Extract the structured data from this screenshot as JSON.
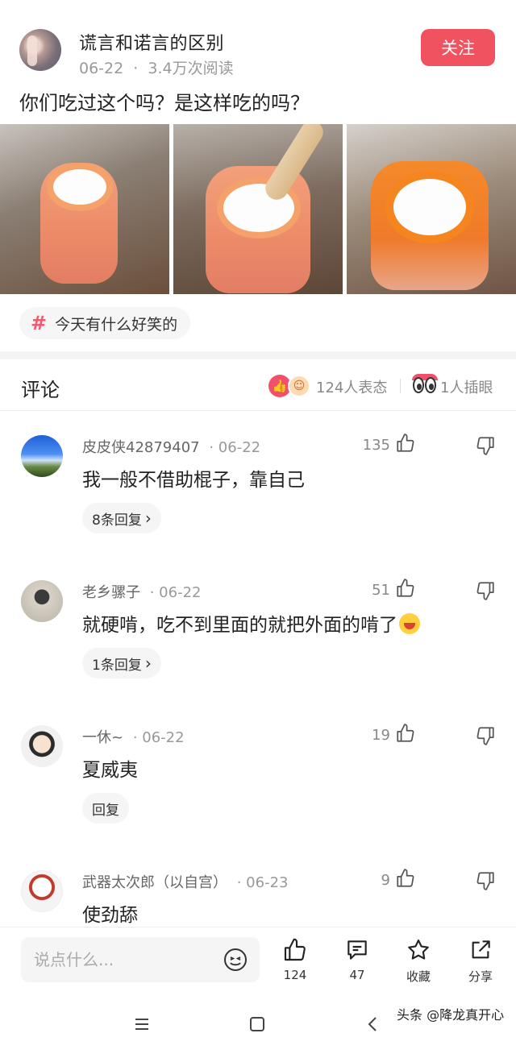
{
  "post": {
    "author_title": "谎言和诺言的区别",
    "date": "06-22",
    "dot": "·",
    "reads": "3.4万次阅读",
    "follow_label": "关注",
    "text": "你们吃过这个吗？是这样吃的吗？",
    "topic": "今天有什么好笑的",
    "topic_icon": "hash-icon"
  },
  "comments_header": {
    "title": "评论",
    "reactions": "124人表态",
    "separator": "|",
    "inserts": "1人插眼"
  },
  "comments": [
    {
      "name": "皮皮侠42879407",
      "date": "· 06-22",
      "likes": "135",
      "text": "我一般不借助棍子，靠自己",
      "reply": "8条回复",
      "reply_arrow": "›"
    },
    {
      "name": "老乡骡子",
      "date": "· 06-22",
      "likes": "51",
      "text": "就硬啃，吃不到里面的就把外面的啃了",
      "reply": "1条回复",
      "reply_arrow": "›"
    },
    {
      "name": "一休~",
      "date": "· 06-22",
      "likes": "19",
      "text": "夏威夷",
      "reply": "回复",
      "reply_arrow": ""
    },
    {
      "name": "武器太次郎（以自宫）",
      "date": "· 06-23",
      "likes": "9",
      "text": "使劲舔"
    }
  ],
  "bottom_bar": {
    "input_placeholder": "说点什么...",
    "like_count": "124",
    "comment_count": "47",
    "favorite_label": "收藏",
    "share_label": "分享"
  },
  "watermark": "头条 @降龙真开心",
  "colors": {
    "accent": "#f0535f",
    "hash": "#ef5a6e"
  }
}
